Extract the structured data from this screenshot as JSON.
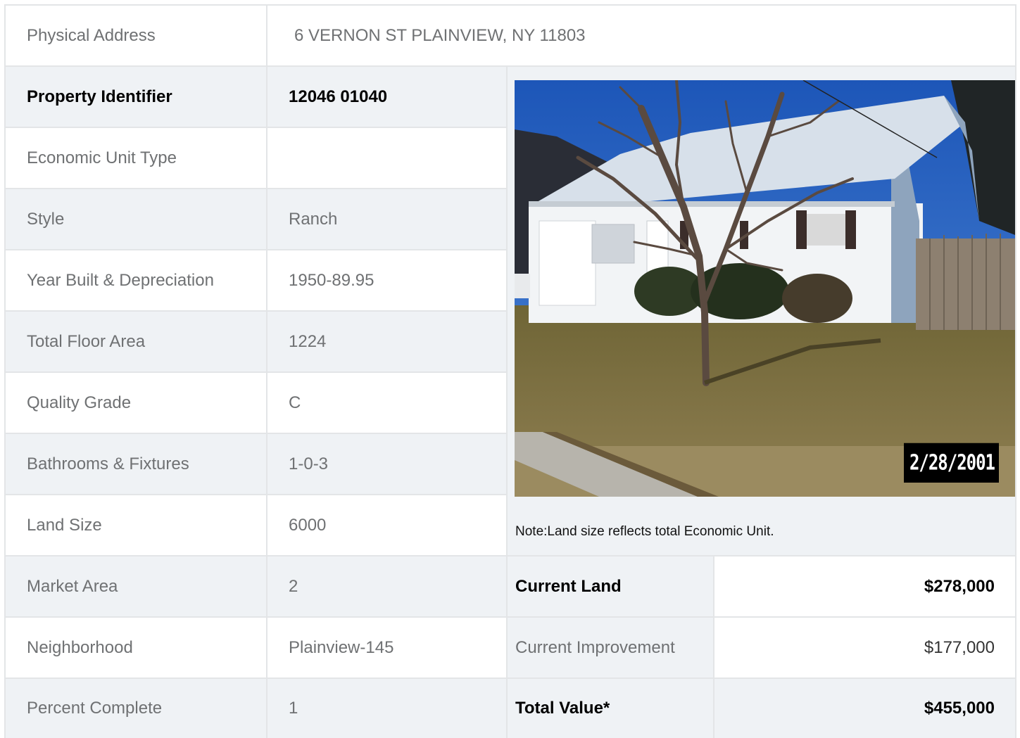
{
  "address": {
    "label": "Physical Address",
    "value": "6  VERNON ST  PLAINVIEW, NY  11803"
  },
  "rows": [
    {
      "label": "Property Identifier",
      "value": "12046  01040"
    },
    {
      "label": "Economic Unit Type",
      "value": ""
    },
    {
      "label": "Style",
      "value": "Ranch"
    },
    {
      "label": "Year Built & Depreciation",
      "value": "1950-89.95"
    },
    {
      "label": "Total Floor Area",
      "value": "1224"
    },
    {
      "label": "Quality Grade",
      "value": "C"
    },
    {
      "label": "Bathrooms & Fixtures",
      "value": "1-0-3"
    },
    {
      "label": "Land Size",
      "value": "6000"
    },
    {
      "label": "Market Area",
      "value": "2"
    },
    {
      "label": "Neighborhood",
      "value": "Plainview-145"
    },
    {
      "label": "Percent Complete",
      "value": "1"
    }
  ],
  "photo": {
    "date_stamp": "2/28/2001"
  },
  "note": "Note:Land size reflects total Economic Unit.",
  "values": [
    {
      "label": "Current Land",
      "value": "$278,000"
    },
    {
      "label": "Current Improvement",
      "value": "$177,000"
    },
    {
      "label": "Total Value*",
      "value": "$455,000"
    }
  ],
  "colors": {
    "row_shade": "#eff2f5",
    "border": "#e3e5e7",
    "label_text": "#6f7173"
  }
}
